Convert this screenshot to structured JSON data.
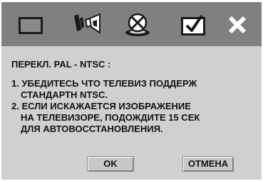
{
  "toolbar": {
    "icons": [
      "display-icon",
      "speaker-icon",
      "disc-icon",
      "checkmark-screen-icon",
      "close-icon"
    ]
  },
  "message": {
    "title": "ПЕРЕКЛ. PAL - NTSC :",
    "line1": "1. УБЕДИТЕСЬ ЧТО ТЕЛЕВИЗ ПОДДЕРЖ",
    "line2": "СТАНДАРТН NTSC.",
    "line3": "2. ЕСЛИ ИСКАЖАЕТСЯ ИЗОБРАЖЕНИЕ",
    "line4": "НА ТЕЛЕВИЗОРЕ, ПОДОЖДИТЕ 15 СЕК",
    "line5": "ДЛЯ АВТОВОССТАНОВЛЕНИЯ."
  },
  "buttons": {
    "ok": "OK",
    "cancel": "ОТМЕНА"
  },
  "colors": {
    "toolbar_bg": "#808080",
    "panel_bg": "#d0d0d0"
  }
}
